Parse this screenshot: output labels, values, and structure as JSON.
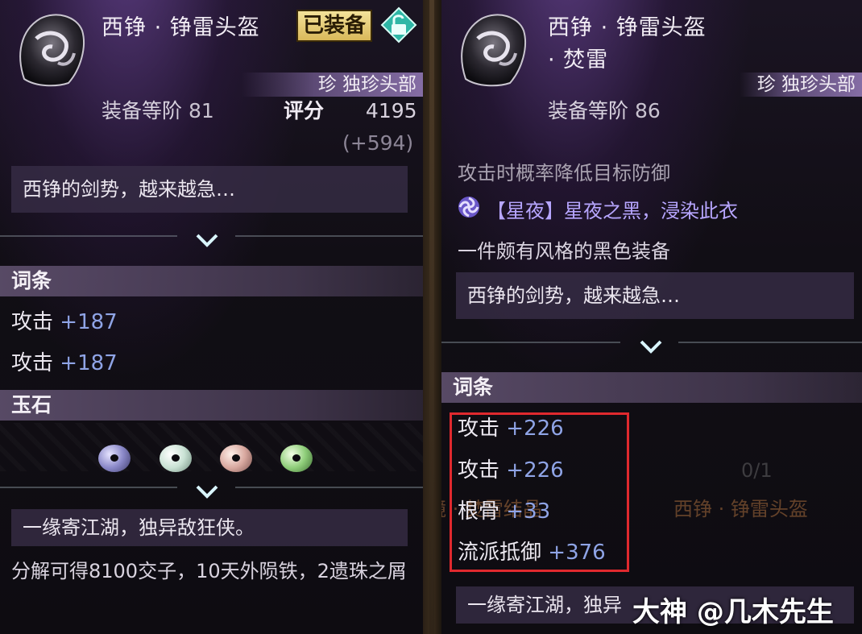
{
  "left_card": {
    "title": "西铮 · 铮雷头盔",
    "equipped_badge": "已装备",
    "rarity": "珍 独珍头部",
    "level_label": "装备等阶",
    "level_value": "81",
    "score_label": "评分",
    "score_value": "4195",
    "score_delta": "(+594)",
    "flavor_text": "西铮的剑势，越来越急…",
    "affix_section": "词条",
    "affixes": [
      {
        "name": "攻击",
        "value": "+187"
      },
      {
        "name": "攻击",
        "value": "+187"
      }
    ],
    "gem_section": "玉石",
    "gems": [
      {
        "color": "#8a88c8"
      },
      {
        "color": "#c9e2d4"
      },
      {
        "color": "#d9a9a0"
      },
      {
        "color": "#8fce7a"
      }
    ],
    "quote_text": "一缘寄江湖，独异敌狂侠。",
    "dismantle_text": "分解可得8100交子，10天外陨铁，2遗珠之屑"
  },
  "right_card": {
    "title_line1": "西铮 · 铮雷头盔",
    "title_line2": "· 焚雷",
    "rarity": "珍 独珍头部",
    "level_label": "装备等阶",
    "level_value": "86",
    "effect_partial": "攻击时概率降低目标防御",
    "set_text": "【星夜】星夜之黑，浸染此衣",
    "style_text": "一件颇有风格的黑色装备",
    "flavor_text": "西铮的剑势，越来越急…",
    "affix_section": "词条",
    "affixes": [
      {
        "name": "攻击",
        "value": "+226"
      },
      {
        "name": "攻击",
        "value": "+226"
      },
      {
        "name": "根骨",
        "value": "+33"
      },
      {
        "name": "流派抵御",
        "value": "+376"
      }
    ],
    "quote_text": "一缘寄江湖，独异",
    "bg_counter": "0/1",
    "bg_item_name": "西铮 · 铮雷头盔",
    "bg_crystal": "镜 · 焚雷结晶"
  },
  "watermark": "大神 @几木先生",
  "colors": {
    "affix_value": "#8fa4e6",
    "set_text": "#b7a6ff",
    "highlight": "#e0292e",
    "badge": "#e8cc72"
  }
}
